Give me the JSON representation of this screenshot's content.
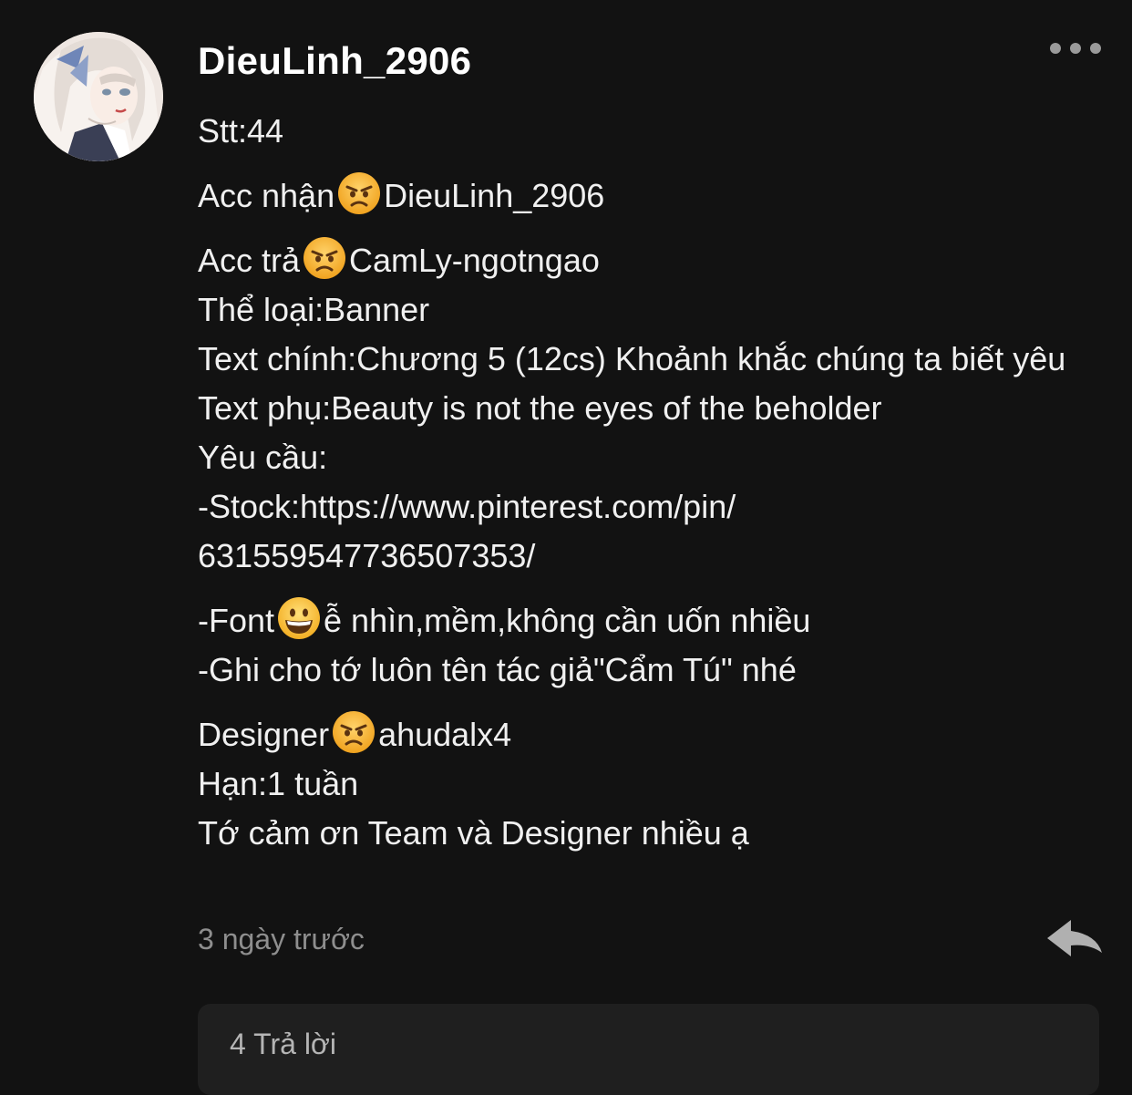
{
  "comment": {
    "username": "DieuLinh_2906",
    "lines": {
      "stt": "Stt:44",
      "acc_nhan_label": "Acc nhận",
      "acc_nhan_value": "DieuLinh_2906",
      "acc_tra_label": "Acc trả",
      "acc_tra_value": "CamLy-ngotngao",
      "the_loai": "Thể loại:Banner",
      "text_chinh": "Text chính:Chương 5 (12cs) Khoảnh khắc chúng ta biết yêu",
      "text_phu": "Text phụ:Beauty is not the eyes of the beholder",
      "yeu_cau": "Yêu cầu:",
      "stock_1": "-Stock:https://www.pinterest.com/pin/",
      "stock_2": "631559547736507353/",
      "font_label": "-Font",
      "font_value": "ễ nhìn,mềm,không cần uốn nhiều",
      "ghi_chu": "-Ghi cho tớ luôn tên tác giả\"Cẩm Tú\" nhé",
      "designer_label": "Designer",
      "designer_value": "ahudalx4",
      "han": "Hạn:1 tuần",
      "cam_on": "Tớ cảm ơn Team và Designer nhiều ạ"
    },
    "timestamp": "3 ngày trước",
    "replies_label": "4 Trả lời"
  },
  "icons": {
    "angry_emoji": "angry-face-emoji",
    "grin_emoji": "grinning-face-emoji",
    "more": "more-horizontal-icon",
    "reply": "reply-arrow-icon"
  },
  "colors": {
    "background": "#121212",
    "text": "#f0f0f0",
    "muted": "#8e8e8e",
    "reply_box": "#1f1f1f"
  }
}
